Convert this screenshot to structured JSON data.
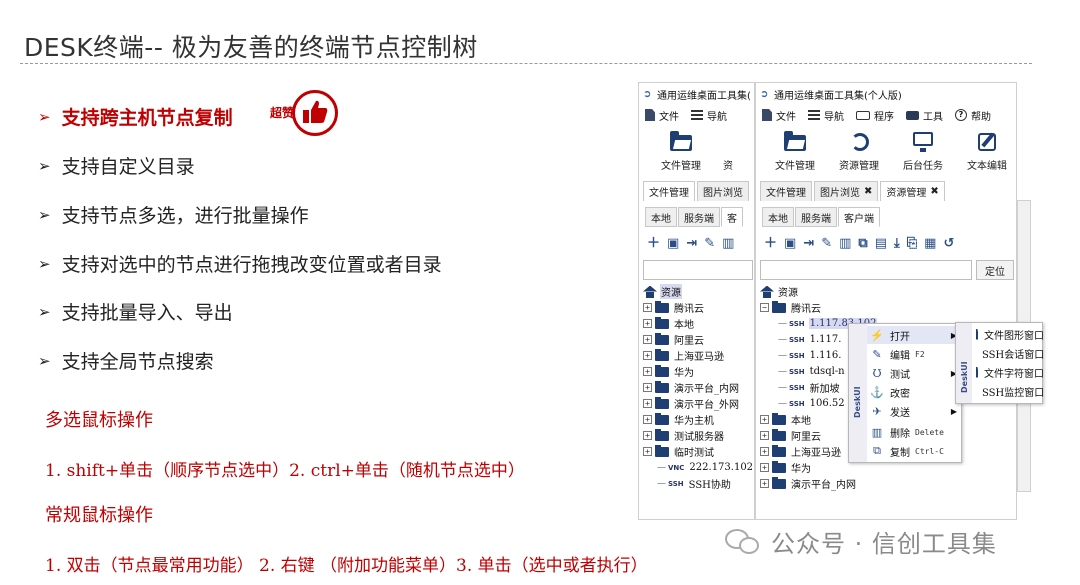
{
  "slide": {
    "title": "DESK终端-- 极为友善的终端节点控制树",
    "bullets": [
      "支持跨主机节点复制",
      "支持自定义目录",
      "支持节点多选，进行批量操作",
      "支持对选中的节点进行拖拽改变位置或者目录",
      "支持批量导入、导出",
      "支持全局节点搜索"
    ],
    "bullet_marker": "➢",
    "badge_text": "超赞",
    "multi_select_heading": "多选鼠标操作",
    "multi_select_text": "1. shift+单击（顺序节点选中）2. ctrl+单击（随机节点选中）",
    "regular_heading": "常规鼠标操作",
    "regular_text": "1. 双击（节点最常用功能） 2. 右键 （附加功能菜单）3. 单击（选中或者执行）"
  },
  "colors": {
    "accent_red": "#c00000",
    "app_blue": "#1f3f73",
    "selection": "#d7d9f0"
  },
  "window_left": {
    "title": "通用运维桌面工具集(",
    "menu": [
      {
        "label": "文件",
        "icon": "document-icon"
      },
      {
        "label": "导航",
        "icon": "list-icon"
      }
    ],
    "ribbon": [
      {
        "label": "文件管理",
        "icon": "folder-icon"
      },
      {
        "label": "资",
        "icon": "resource-icon"
      }
    ],
    "tabs": [
      {
        "label": "文件管理"
      },
      {
        "label": "图片浏览"
      }
    ],
    "subtabs": [
      "本地",
      "服务端",
      "客"
    ],
    "tree": [
      {
        "label": "资源",
        "type": "root"
      },
      {
        "label": "腾讯云",
        "type": "folder"
      },
      {
        "label": "本地",
        "type": "folder"
      },
      {
        "label": "阿里云",
        "type": "folder"
      },
      {
        "label": "上海亚马逊",
        "type": "folder"
      },
      {
        "label": "华为",
        "type": "folder"
      },
      {
        "label": "演示平台_内网",
        "type": "folder"
      },
      {
        "label": "演示平台_外网",
        "type": "folder"
      },
      {
        "label": "华为主机",
        "type": "folder"
      },
      {
        "label": "测试服务器",
        "type": "folder"
      },
      {
        "label": "临时测试",
        "type": "folder"
      },
      {
        "label": "222.173.102.",
        "type": "conn",
        "proto": "VNC"
      },
      {
        "label": "SSH协助",
        "type": "conn",
        "proto": "SSH"
      }
    ]
  },
  "window_right": {
    "title": "通用运维桌面工具集(个人版)",
    "menu": [
      {
        "label": "文件",
        "icon": "document-icon"
      },
      {
        "label": "导航",
        "icon": "list-icon"
      },
      {
        "label": "程序",
        "icon": "keyboard-icon"
      },
      {
        "label": "工具",
        "icon": "toolbox-icon"
      },
      {
        "label": "帮助",
        "icon": "help-icon"
      }
    ],
    "ribbon": [
      {
        "label": "文件管理",
        "icon": "folder-icon"
      },
      {
        "label": "资源管理",
        "icon": "resource-icon"
      },
      {
        "label": "后台任务",
        "icon": "monitor-icon"
      },
      {
        "label": "文本编辑",
        "icon": "edit-icon"
      }
    ],
    "tabs": [
      {
        "label": "文件管理"
      },
      {
        "label": "图片浏览",
        "closable": "✖"
      },
      {
        "label": "资源管理",
        "closable": "✖"
      }
    ],
    "subtabs": [
      "本地",
      "服务端",
      "客户端"
    ],
    "locate_label": "定位",
    "tree": [
      {
        "label": "资源",
        "type": "root"
      },
      {
        "label": "腾讯云",
        "type": "folder",
        "open": "⊟"
      },
      {
        "label": "1.117.83.102",
        "type": "conn",
        "proto": "SSH",
        "selected": "yes"
      },
      {
        "label": "1.117.",
        "type": "conn",
        "proto": "SSH"
      },
      {
        "label": "1.116.",
        "type": "conn",
        "proto": "SSH"
      },
      {
        "label": "tdsql-n",
        "type": "conn",
        "proto": "SSH"
      },
      {
        "label": "新加坡",
        "type": "conn",
        "proto": "SSH"
      },
      {
        "label": "106.52",
        "type": "conn",
        "proto": "SSH"
      },
      {
        "label": "本地",
        "type": "folder"
      },
      {
        "label": "阿里云",
        "type": "folder"
      },
      {
        "label": "上海亚马逊",
        "type": "folder"
      },
      {
        "label": "华为",
        "type": "folder"
      },
      {
        "label": "演示平台_内网",
        "type": "folder"
      }
    ],
    "context_menu": {
      "brand": "DeskUI",
      "items": [
        {
          "label": "打开",
          "icon": "bolt-icon",
          "submenu": "▶"
        },
        {
          "label": "编辑",
          "icon": "pencil-icon",
          "shortcut": "F2"
        },
        {
          "label": "测试",
          "icon": "magnet-icon",
          "submenu": "▶"
        },
        {
          "label": "改密",
          "icon": "anchor-icon"
        },
        {
          "label": "发送",
          "icon": "plane-icon",
          "submenu": "▶"
        },
        {
          "label": "删除",
          "icon": "trash-icon",
          "shortcut": "Delete"
        },
        {
          "label": "复制",
          "icon": "copy-icon",
          "shortcut": "Ctrl-C"
        }
      ]
    },
    "submenu": {
      "brand": "DeskUI",
      "items": [
        "文件图形窗口",
        "SSH会话窗口",
        "文件字符窗口",
        "SSH监控窗口"
      ]
    }
  },
  "watermark": {
    "text": "公众号 · 信创工具集"
  }
}
